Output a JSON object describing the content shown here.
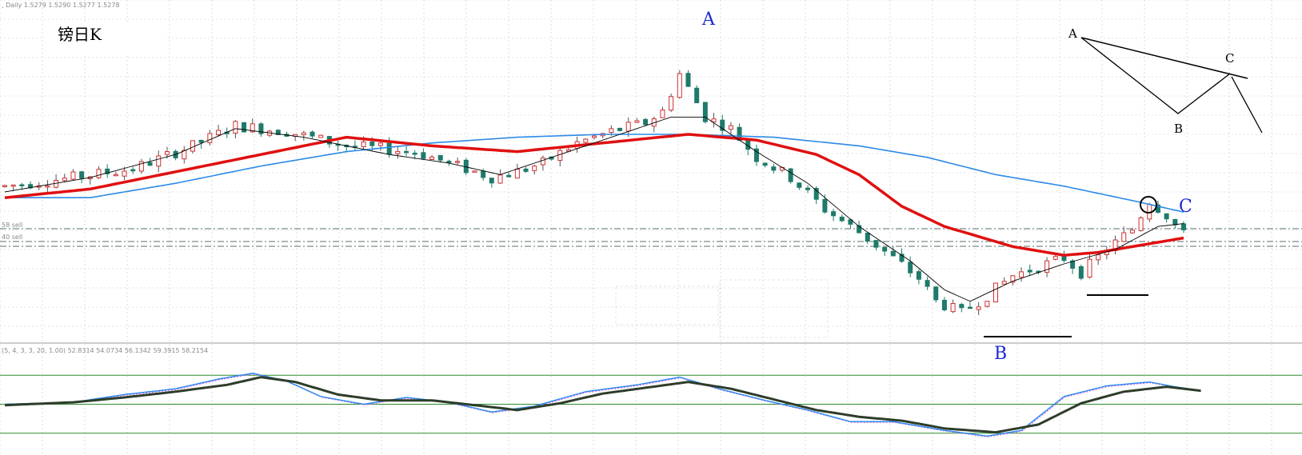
{
  "header": {
    "symbol_info": ", Daily  1.5279 1.5290 1.5277 1.5278"
  },
  "title": "镑日K",
  "labels": {
    "point_a": "A",
    "point_b": "B",
    "point_c": "C"
  },
  "diagram_labels": {
    "a": "A",
    "b": "B",
    "c": "C"
  },
  "price_tags": {
    "upper": "58 sell",
    "lower": "40 sell"
  },
  "oscillator": {
    "info": "(5, 4, 3, 3, 20, 1.00) 52.8314 54.0734 56.1342 59.3915 58.2154",
    "levels": [
      80,
      50,
      20
    ]
  },
  "colors": {
    "bull_candle": "#d03030",
    "bear_candle": "#1e7a6a",
    "ma_fast": "#000000",
    "ma_red": "#e01010",
    "ma_blue": "#2c8ae6",
    "osc_main": "#2e8cf0",
    "osc_signal": "#2e3d2a",
    "level_line": "#2e8b2e",
    "grid": "#c8c8c8",
    "label_blue": "#1a28d8"
  },
  "chart_data": {
    "type": "candlestick",
    "notes": "Daily GBP/JPY candlesticks with moving averages and stochastic oscillator; values read as approximate 0-100 normalized price scale (no price axis printed).",
    "key_points": [
      {
        "name": "A",
        "value": 91
      },
      {
        "name": "B",
        "value": 8
      },
      {
        "name": "C",
        "value": 47
      }
    ],
    "price_path": [
      [
        0,
        52
      ],
      [
        8,
        55
      ],
      [
        15,
        58
      ],
      [
        22,
        66
      ],
      [
        27,
        73
      ],
      [
        33,
        71
      ],
      [
        40,
        66
      ],
      [
        48,
        64
      ],
      [
        52,
        60
      ],
      [
        57,
        55
      ],
      [
        60,
        57
      ],
      [
        63,
        60
      ],
      [
        67,
        67
      ],
      [
        71,
        71
      ],
      [
        75,
        74
      ],
      [
        77,
        78
      ],
      [
        79,
        91
      ],
      [
        82,
        76
      ],
      [
        85,
        72
      ],
      [
        88,
        62
      ],
      [
        92,
        55
      ],
      [
        96,
        44
      ],
      [
        100,
        36
      ],
      [
        104,
        27
      ],
      [
        107,
        20
      ],
      [
        109,
        12
      ],
      [
        112,
        8
      ],
      [
        115,
        14
      ],
      [
        118,
        21
      ],
      [
        121,
        24
      ],
      [
        124,
        27
      ],
      [
        126,
        22
      ],
      [
        129,
        30
      ],
      [
        132,
        37
      ],
      [
        134,
        47
      ],
      [
        136,
        42
      ],
      [
        138,
        35
      ]
    ],
    "ma_fast": [
      [
        0,
        50
      ],
      [
        10,
        55
      ],
      [
        20,
        63
      ],
      [
        27,
        72
      ],
      [
        35,
        69
      ],
      [
        45,
        63
      ],
      [
        52,
        60
      ],
      [
        58,
        56
      ],
      [
        65,
        63
      ],
      [
        72,
        70
      ],
      [
        78,
        76
      ],
      [
        82,
        76
      ],
      [
        88,
        64
      ],
      [
        94,
        53
      ],
      [
        100,
        38
      ],
      [
        106,
        26
      ],
      [
        110,
        16
      ],
      [
        113,
        12
      ],
      [
        118,
        19
      ],
      [
        124,
        25
      ],
      [
        130,
        30
      ],
      [
        135,
        38
      ],
      [
        138,
        39
      ]
    ],
    "ma_red": [
      [
        0,
        48
      ],
      [
        10,
        51
      ],
      [
        20,
        57
      ],
      [
        30,
        63
      ],
      [
        40,
        69
      ],
      [
        50,
        66
      ],
      [
        60,
        64
      ],
      [
        70,
        67
      ],
      [
        80,
        70
      ],
      [
        88,
        68
      ],
      [
        95,
        63
      ],
      [
        100,
        56
      ],
      [
        105,
        45
      ],
      [
        110,
        38
      ],
      [
        118,
        31
      ],
      [
        124,
        28
      ],
      [
        128,
        29
      ],
      [
        134,
        32
      ],
      [
        138,
        34
      ]
    ],
    "ma_blue": [
      [
        0,
        48
      ],
      [
        10,
        48
      ],
      [
        20,
        53
      ],
      [
        30,
        59
      ],
      [
        40,
        64
      ],
      [
        50,
        67
      ],
      [
        60,
        69
      ],
      [
        70,
        70
      ],
      [
        80,
        70
      ],
      [
        90,
        69
      ],
      [
        100,
        66
      ],
      [
        108,
        62
      ],
      [
        116,
        56
      ],
      [
        124,
        52
      ],
      [
        132,
        47
      ],
      [
        138,
        43
      ]
    ],
    "oscillator_main": [
      [
        0,
        50
      ],
      [
        8,
        52
      ],
      [
        14,
        60
      ],
      [
        20,
        66
      ],
      [
        25,
        76
      ],
      [
        29,
        82
      ],
      [
        33,
        74
      ],
      [
        37,
        58
      ],
      [
        42,
        50
      ],
      [
        47,
        57
      ],
      [
        52,
        52
      ],
      [
        57,
        42
      ],
      [
        62,
        48
      ],
      [
        68,
        63
      ],
      [
        74,
        70
      ],
      [
        79,
        78
      ],
      [
        84,
        65
      ],
      [
        89,
        54
      ],
      [
        94,
        44
      ],
      [
        99,
        32
      ],
      [
        104,
        32
      ],
      [
        110,
        23
      ],
      [
        115,
        17
      ],
      [
        119,
        23
      ],
      [
        124,
        58
      ],
      [
        129,
        69
      ],
      [
        134,
        73
      ],
      [
        137,
        68
      ],
      [
        140,
        64
      ]
    ],
    "oscillator_signal": [
      [
        0,
        49
      ],
      [
        8,
        52
      ],
      [
        14,
        57
      ],
      [
        20,
        63
      ],
      [
        26,
        70
      ],
      [
        30,
        78
      ],
      [
        34,
        73
      ],
      [
        39,
        60
      ],
      [
        44,
        54
      ],
      [
        50,
        54
      ],
      [
        55,
        49
      ],
      [
        60,
        44
      ],
      [
        65,
        51
      ],
      [
        70,
        61
      ],
      [
        75,
        67
      ],
      [
        80,
        73
      ],
      [
        85,
        66
      ],
      [
        90,
        55
      ],
      [
        95,
        44
      ],
      [
        100,
        37
      ],
      [
        105,
        33
      ],
      [
        110,
        25
      ],
      [
        116,
        21
      ],
      [
        121,
        29
      ],
      [
        126,
        51
      ],
      [
        131,
        63
      ],
      [
        136,
        68
      ],
      [
        140,
        64
      ]
    ],
    "ylim": [
      0,
      100
    ]
  }
}
